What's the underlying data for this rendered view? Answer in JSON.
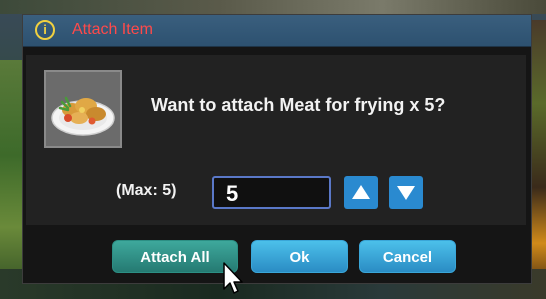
{
  "dialog": {
    "title": "Attach Item",
    "title_icon": "info-icon",
    "message": "Want to attach Meat for frying x 5?",
    "item_icon": "fried-food-plate-icon"
  },
  "quantity": {
    "max_label": "(Max: 5)",
    "value": "5",
    "up_icon": "arrow-up-icon",
    "down_icon": "arrow-down-icon"
  },
  "buttons": {
    "attach_all": "Attach All",
    "ok": "Ok",
    "cancel": "Cancel"
  },
  "colors": {
    "titlebar": "#2d5170",
    "title_text": "#ff4a4a",
    "icon_yellow": "#f0d040",
    "input_border": "#5a78c8",
    "arrow_button": "#2a8ad0",
    "attach_button": "#257a72",
    "ok_button": "#2a8cc4"
  }
}
